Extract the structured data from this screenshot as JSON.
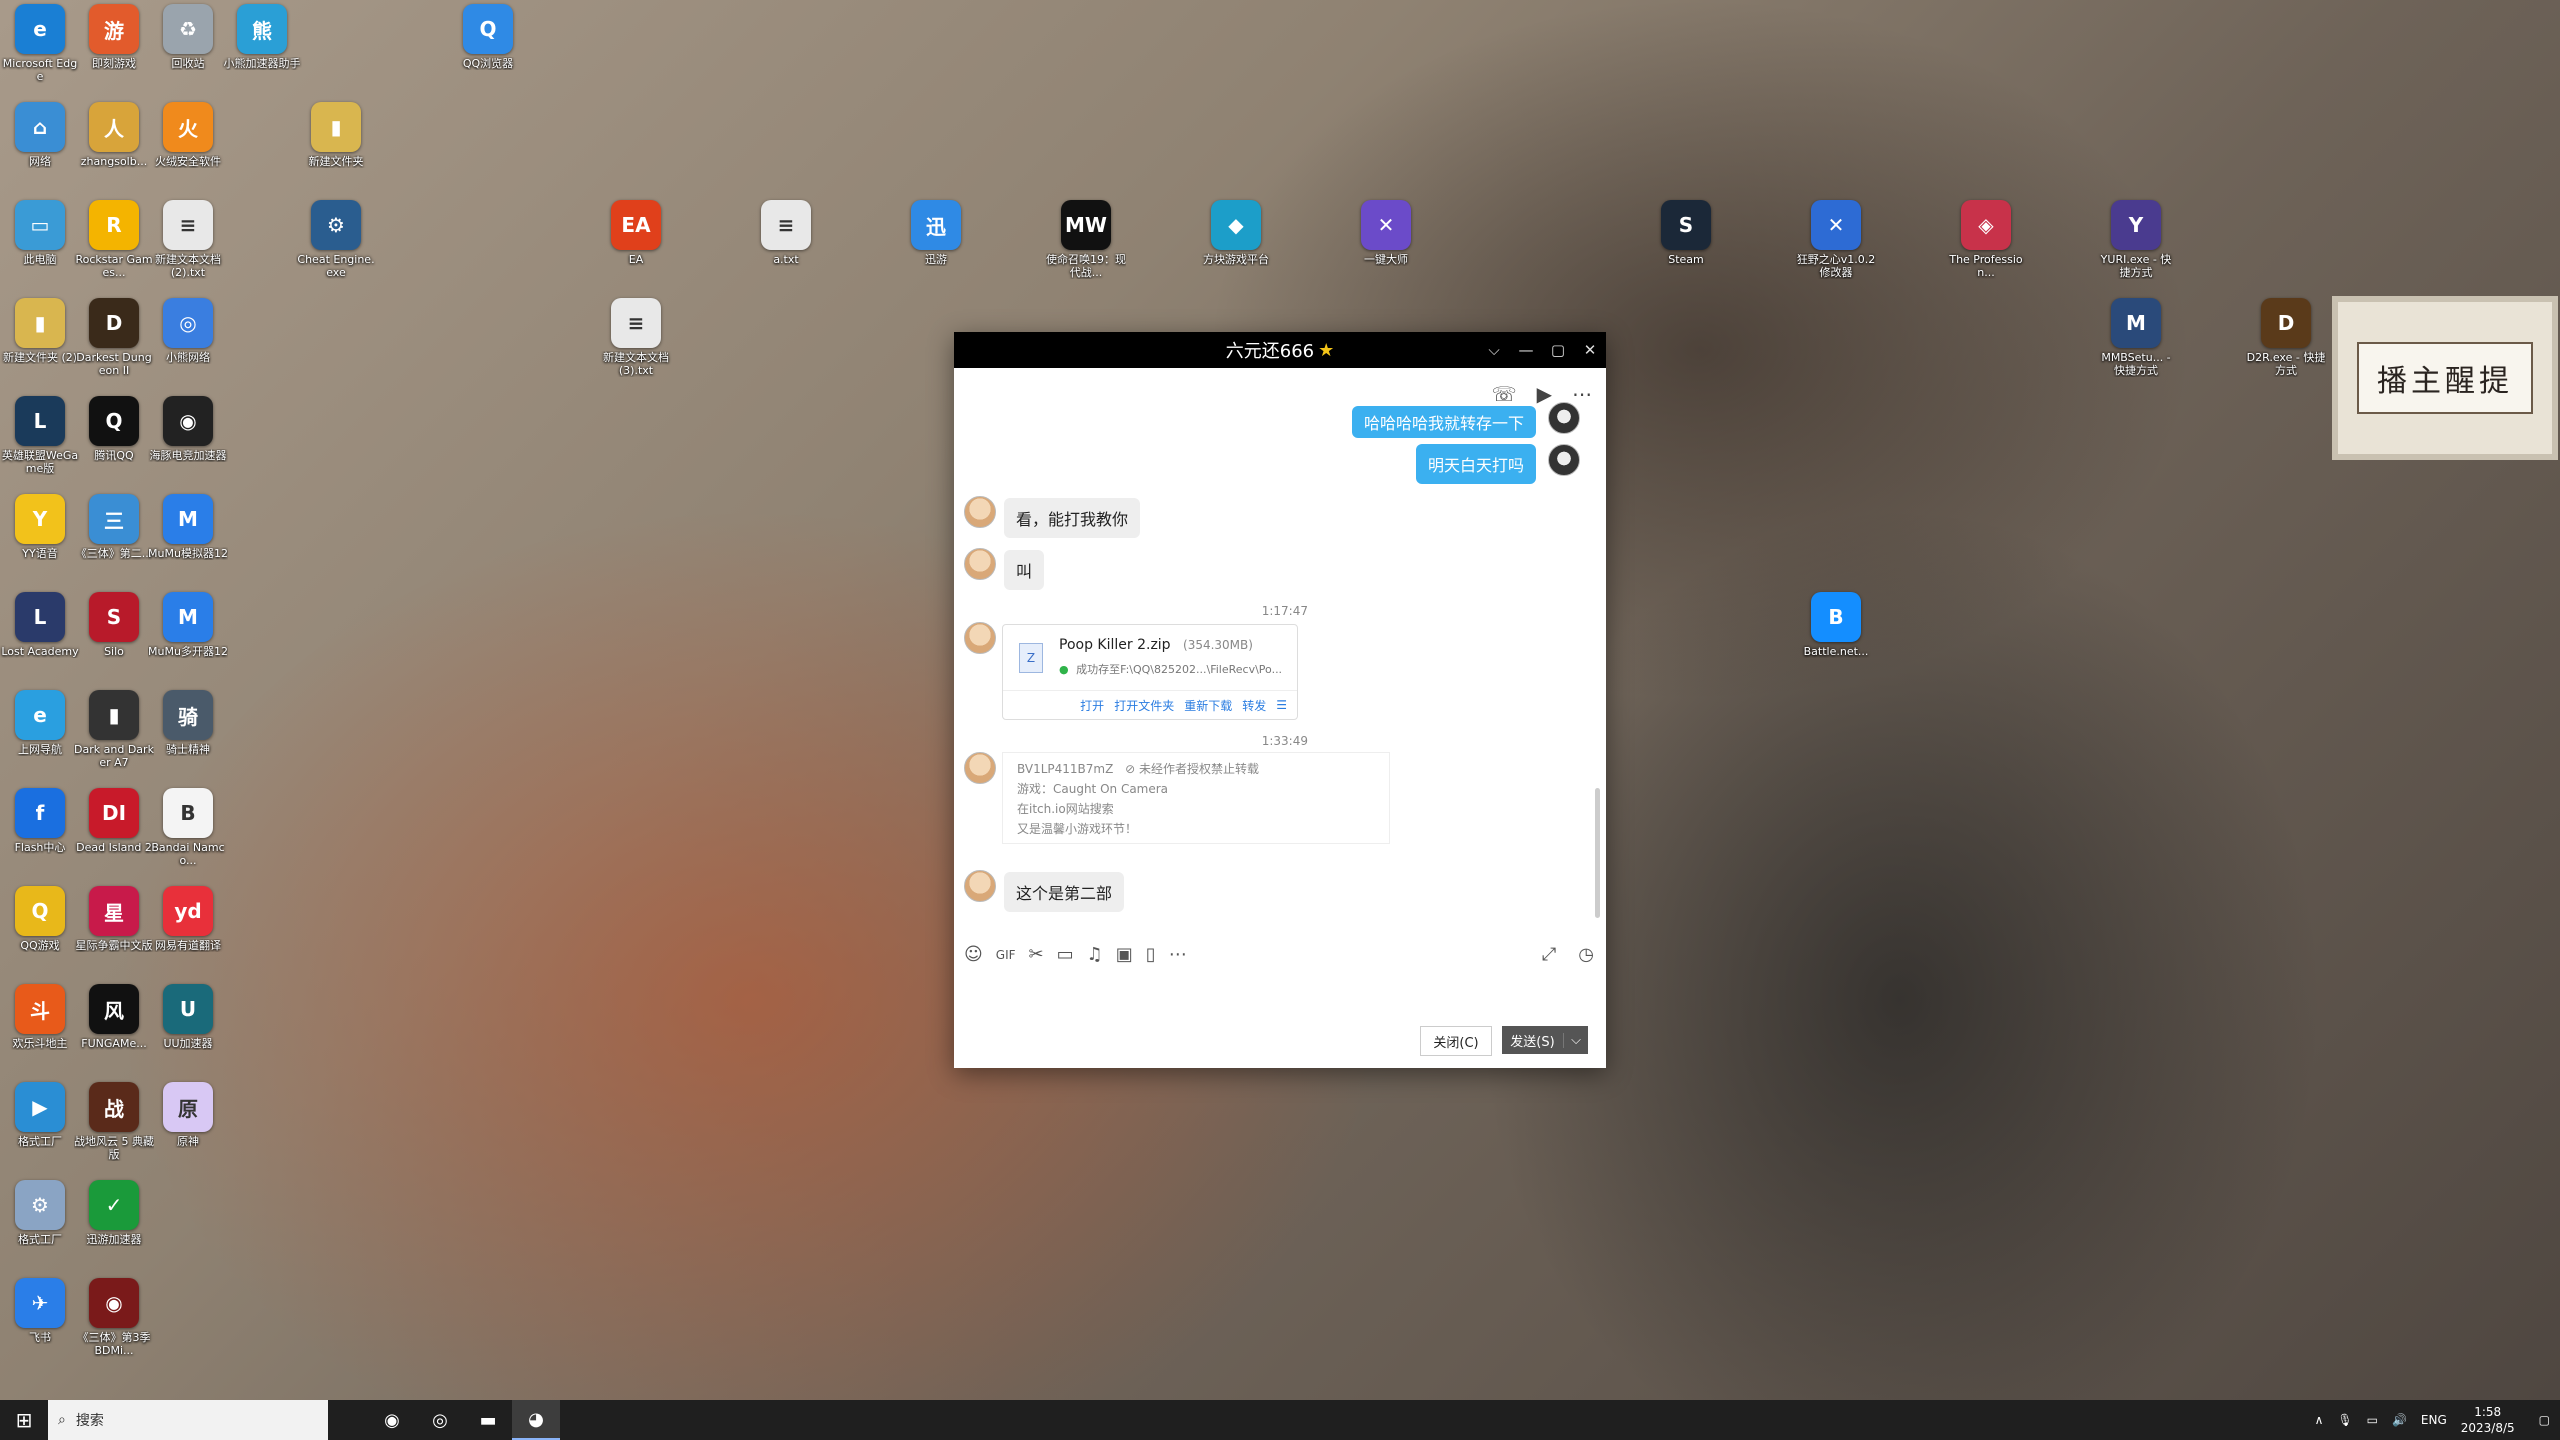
{
  "desktop_icons": [
    {
      "label": "Microsoft Edge",
      "glyph": "e",
      "color": "#1a7fd4"
    },
    {
      "label": "即刻游戏",
      "glyph": "游",
      "color": "#e25b2c"
    },
    {
      "label": "回收站",
      "glyph": "♻",
      "color": "#9aa4ad"
    },
    {
      "label": "小熊加速器助手",
      "glyph": "熊",
      "color": "#2a9fd6"
    },
    {
      "label": "QQ浏览器",
      "glyph": "Q",
      "color": "#2f8ae5"
    },
    {
      "label": "网络",
      "glyph": "⌂",
      "color": "#3a8ed4"
    },
    {
      "label": "zhangsolb...",
      "glyph": "人",
      "color": "#d8a43a"
    },
    {
      "label": "火绒安全软件",
      "glyph": "火",
      "color": "#f08a1c"
    },
    {
      "label": "新建文件夹",
      "glyph": "▮",
      "color": "#d9b64f"
    },
    {
      "label": "此电脑",
      "glyph": "▭",
      "color": "#3a9bd6"
    },
    {
      "label": "Rockstar Games...",
      "glyph": "R",
      "color": "#f4b400"
    },
    {
      "label": "新建文本文档 (2).txt",
      "glyph": "≡",
      "color": "#e8e8e8"
    },
    {
      "label": "Cheat Engine.exe",
      "glyph": "⚙",
      "color": "#2a5d8f"
    },
    {
      "label": "EA",
      "glyph": "EA",
      "color": "#e0401b"
    },
    {
      "label": "a.txt",
      "glyph": "≡",
      "color": "#e8e8e8"
    },
    {
      "label": "迅游",
      "glyph": "迅",
      "color": "#2f8ae5"
    },
    {
      "label": "使命召唤19：现代战...",
      "glyph": "MW",
      "color": "#111111"
    },
    {
      "label": "方块游戏平台",
      "glyph": "◆",
      "color": "#1c9ec9"
    },
    {
      "label": "一键大师",
      "glyph": "✕",
      "color": "#6b4bc9"
    },
    {
      "label": "Steam",
      "glyph": "S",
      "color": "#1b2838"
    },
    {
      "label": "狂野之心v1.0.2修改器",
      "glyph": "✕",
      "color": "#2d6bd4"
    },
    {
      "label": "The Profession...",
      "glyph": "◈",
      "color": "#c8324a"
    },
    {
      "label": "YURI.exe - 快捷方式",
      "glyph": "Y",
      "color": "#4a3b8f"
    },
    {
      "label": "新建文件夹 (2)",
      "glyph": "▮",
      "color": "#d9b64f"
    },
    {
      "label": "Darkest Dungeon II",
      "glyph": "D",
      "color": "#3a2a1a"
    },
    {
      "label": "小熊网络",
      "glyph": "◎",
      "color": "#3a7ee0"
    },
    {
      "label": "新建文本文档 (3).txt",
      "glyph": "≡",
      "color": "#e8e8e8"
    },
    {
      "label": "MMBSetu... - 快捷方式",
      "glyph": "M",
      "color": "#2a4a7a"
    },
    {
      "label": "D2R.exe - 快捷方式",
      "glyph": "D",
      "color": "#5a3a1a"
    },
    {
      "label": "英雄联盟WeGame版",
      "glyph": "L",
      "color": "#1a3a5a"
    },
    {
      "label": "腾讯QQ",
      "glyph": "Q",
      "color": "#111111"
    },
    {
      "label": "海豚电竞加速器",
      "glyph": "◉",
      "color": "#222222"
    },
    {
      "label": "YY语音",
      "glyph": "Y",
      "color": "#f2c21b"
    },
    {
      "label": "《三体》第二...",
      "glyph": "三",
      "color": "#3a8ed4"
    },
    {
      "label": "MuMu模拟器12",
      "glyph": "M",
      "color": "#2a7ee8"
    },
    {
      "label": "Lost Academy",
      "glyph": "L",
      "color": "#2a3a6a"
    },
    {
      "label": "Silo",
      "glyph": "S",
      "color": "#b81a2a"
    },
    {
      "label": "MuMu多开器12",
      "glyph": "M",
      "color": "#2a7ee8"
    },
    {
      "label": "Battle.net...",
      "glyph": "B",
      "color": "#148eff"
    },
    {
      "label": "上网导航",
      "glyph": "e",
      "color": "#2a9fe0"
    },
    {
      "label": "Dark and Darker A7",
      "glyph": "▮",
      "color": "#333333"
    },
    {
      "label": "骑士精神",
      "glyph": "骑",
      "color": "#4a5a6a"
    },
    {
      "label": "Flash中心",
      "glyph": "f",
      "color": "#1a6fe0"
    },
    {
      "label": "Dead Island 2",
      "glyph": "DI",
      "color": "#c81a2a"
    },
    {
      "label": "Bandai Namco...",
      "glyph": "B",
      "color": "#f4f4f4"
    },
    {
      "label": "QQ游戏",
      "glyph": "Q",
      "color": "#e8b81a"
    },
    {
      "label": "星际争霸中文版",
      "glyph": "星",
      "color": "#c81a4a"
    },
    {
      "label": "网易有道翻译",
      "glyph": "yd",
      "color": "#e8303a"
    },
    {
      "label": "欢乐斗地主",
      "glyph": "斗",
      "color": "#e85a1a"
    },
    {
      "label": "FUNGAMe...",
      "glyph": "风",
      "color": "#111111"
    },
    {
      "label": "UU加速器",
      "glyph": "U",
      "color": "#1a6a7a"
    },
    {
      "label": "格式工厂",
      "glyph": "▶",
      "color": "#2a8ed4"
    },
    {
      "label": "战地风云 5 典藏版",
      "glyph": "战",
      "color": "#5a2a1a"
    },
    {
      "label": "原神",
      "glyph": "原",
      "color": "#d8c8f4"
    },
    {
      "label": "格式工厂",
      "glyph": "⚙",
      "color": "#8aa4c4"
    },
    {
      "label": "迅游加速器",
      "glyph": "✓",
      "color": "#1a9a3a"
    },
    {
      "label": "飞书",
      "glyph": "✈",
      "color": "#2a7ee8"
    },
    {
      "label": "《三体》第3季 BDMi...",
      "glyph": "◉",
      "color": "#7a1a1a"
    }
  ],
  "frame_text": "播主醒提",
  "chat": {
    "title": "六元还666",
    "title_star": "★",
    "controls": {
      "menu": "⌵",
      "min": "—",
      "max": "▢",
      "close": "✕"
    },
    "top_tools": {
      "call": "☏",
      "video": "▶",
      "more": "⋯"
    },
    "messages": {
      "m1": "哈哈哈哈我就转存一下",
      "m2": "明天白天打吗",
      "m3": "看，能打我教你",
      "m4": "叫",
      "ts1": "1:17:47",
      "file_name": "Poop Killer 2.zip",
      "file_size": "(354.30MB)",
      "file_path": "成功存至F:\\QQ\\825202...\\FileRecv\\Po...",
      "file_actions": [
        "打开",
        "打开文件夹",
        "重新下载",
        "转发",
        "☰"
      ],
      "ts2": "1:33:49",
      "share_id": "BV1LP411B7mZ",
      "share_note": "未经作者授权禁止转载",
      "share_l1": "游戏：Caught On Camera",
      "share_l2": "在itch.io网站搜索",
      "share_l3": "又是温馨小游戏环节！",
      "m5": "这个是第二部"
    },
    "input_tools": [
      "☺",
      "GIF",
      "✂",
      "▭",
      "♫",
      "▣",
      "▯",
      "⋯"
    ],
    "input_right": [
      "⤢",
      "◷"
    ],
    "close_btn": "关闭(C)",
    "send_btn": "发送(S)",
    "send_arrow": "⌵"
  },
  "taskbar": {
    "start": "⊞",
    "search_icon": "⌕",
    "search_text": "搜索",
    "apps": [
      "◉",
      "◎",
      "▬",
      "◕"
    ],
    "tray": {
      "up": "∧",
      "mic": "🎙",
      "net": "▭",
      "vol": "🔊",
      "lang": "ENG"
    },
    "time": "1:58",
    "date": "2023/8/5",
    "notify": "▢"
  }
}
